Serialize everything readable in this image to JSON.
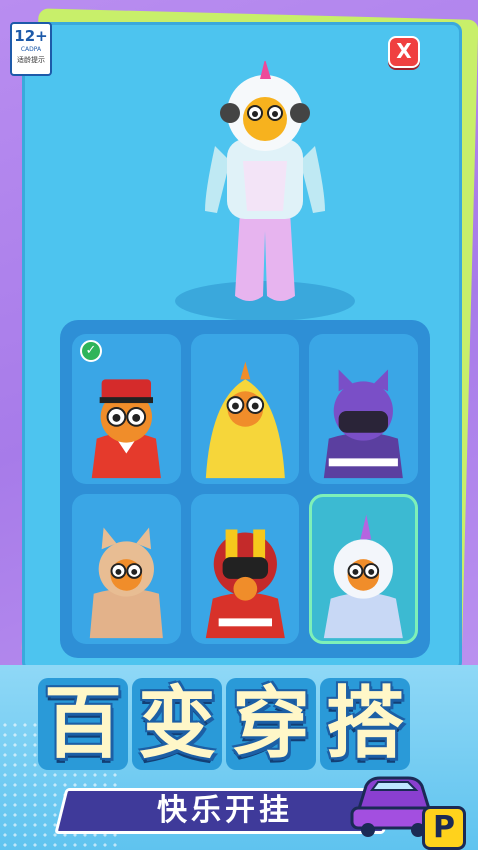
{
  "rating_badge": {
    "age": "12+",
    "org": "CADPA",
    "tip": "适龄提示"
  },
  "close_label": "X",
  "outfits": [
    {
      "name": "bellhop",
      "selected": false,
      "owned": true
    },
    {
      "name": "chicken",
      "selected": false,
      "owned": false
    },
    {
      "name": "purple-cat",
      "selected": false,
      "owned": false
    },
    {
      "name": "cat-costume",
      "selected": false,
      "owned": false
    },
    {
      "name": "racer",
      "selected": false,
      "owned": false
    },
    {
      "name": "unicorn",
      "selected": true,
      "owned": false
    }
  ],
  "banner": {
    "title_chars": [
      "百",
      "变",
      "穿",
      "搭"
    ],
    "subtitle": "快乐开挂"
  },
  "parking_badge": "P",
  "colors": {
    "panel": "#4dc4ef",
    "grid": "#2e8fd6",
    "check": "#2fb45a",
    "close": "#f04040"
  }
}
